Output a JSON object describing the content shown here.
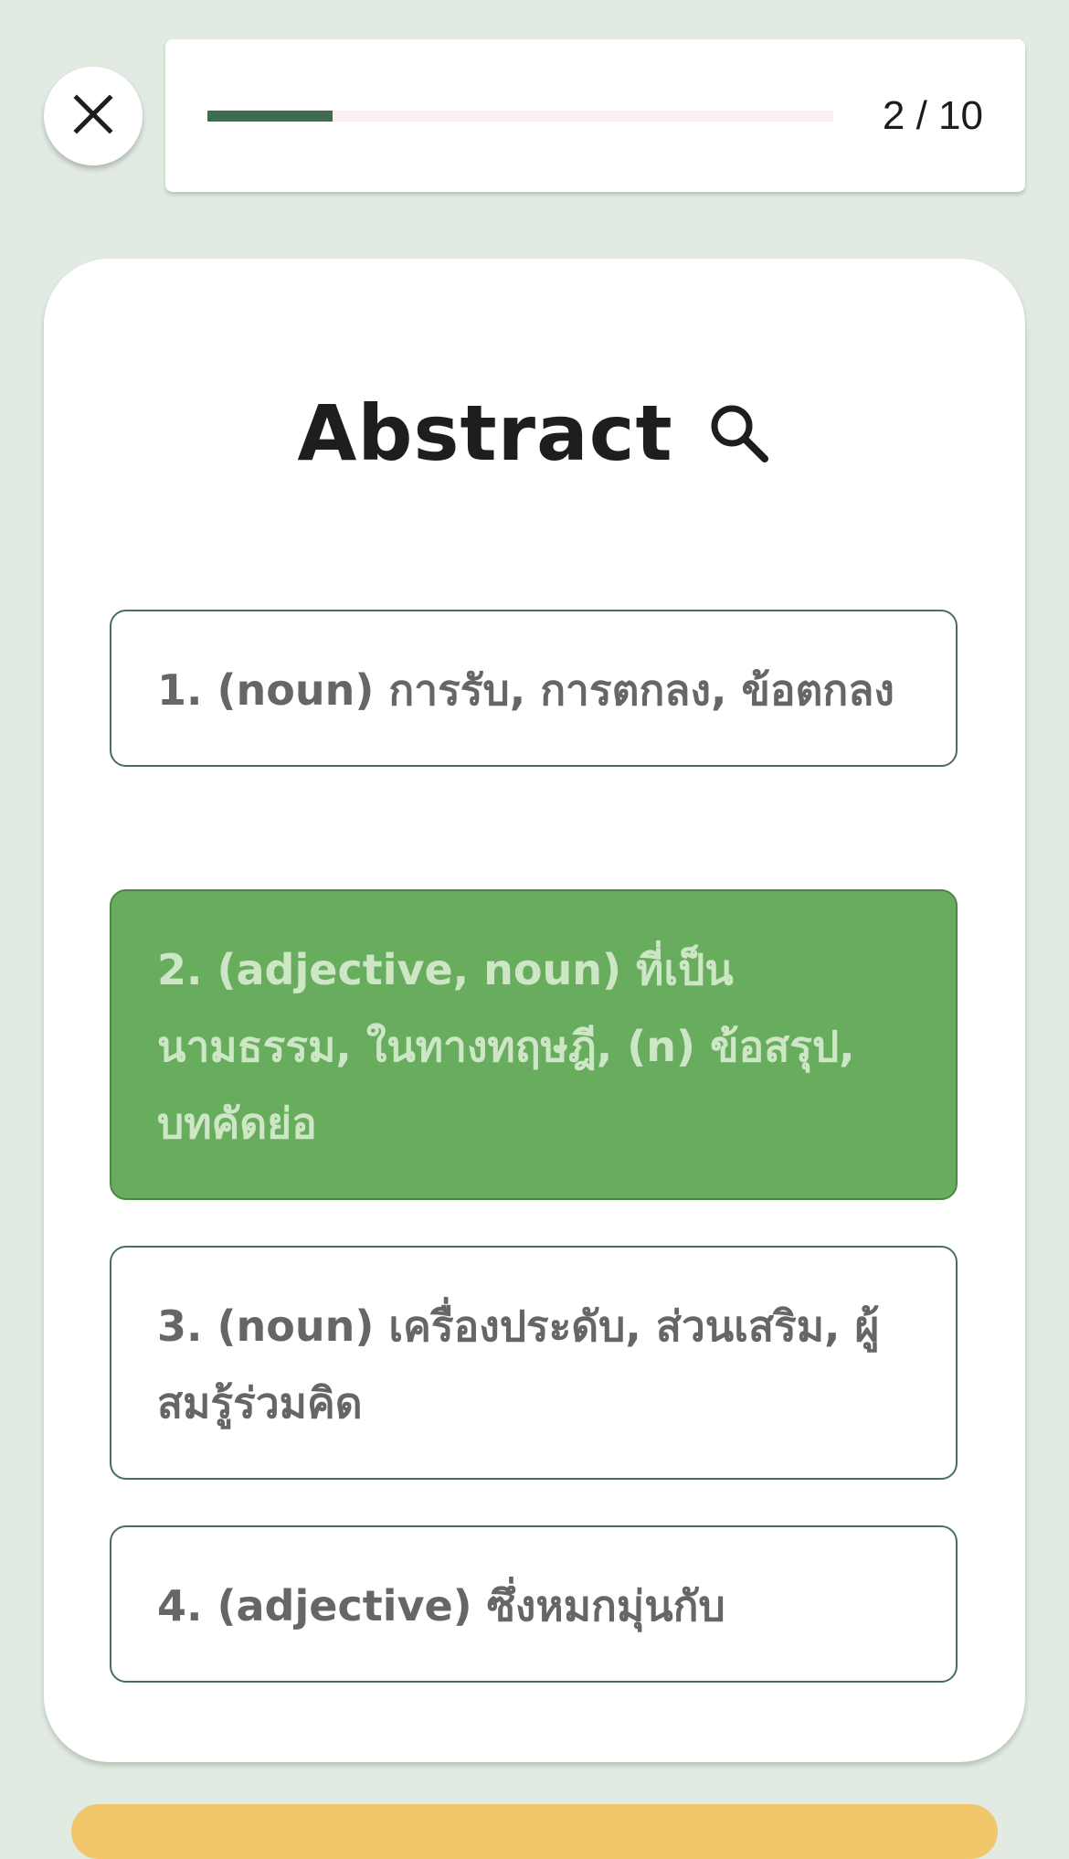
{
  "quiz": {
    "current": 2,
    "total": 10,
    "progress_fraction": 0.2,
    "progress_label": "2 / 10"
  },
  "colors": {
    "background": "#e1ebe2",
    "progress_fill": "#3e6b52",
    "option_border": "#4a6f59",
    "selected_bg": "#68ad5d",
    "bottom_button": "#f2c76c"
  },
  "icons": {
    "close": "close-icon",
    "lookup": "search-icon"
  },
  "card": {
    "word": "Abstract"
  },
  "options": [
    {
      "label": "1. (noun) การรับ, การตกลง, ข้อตกลง",
      "selected": false
    },
    {
      "label": "2. (adjective, noun) ที่เป็นนามธรรม, ในทางทฤษฎี, (n) ข้อสรุป, บทคัดย่อ",
      "selected": true
    },
    {
      "label": "3. (noun) เครื่องประดับ, ส่วนเสริม, ผู้สมรู้ร่วมคิด",
      "selected": false
    },
    {
      "label": "4. (adjective) ซึ่งหมกมุ่นกับ",
      "selected": false
    }
  ]
}
